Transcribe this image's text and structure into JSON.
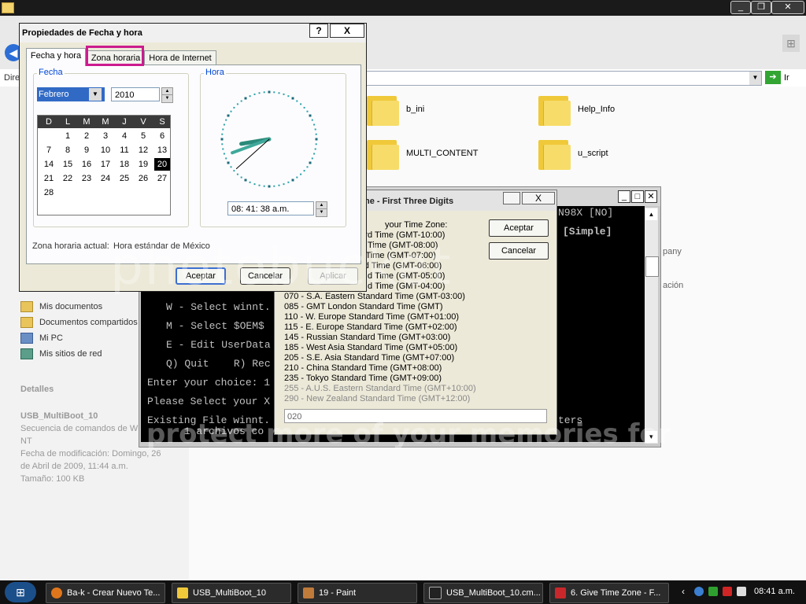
{
  "explorer": {
    "minimize_label": "_",
    "restore_label": "❐",
    "close_label": "✕",
    "address_label": "Direcciones",
    "go_label": "Ir",
    "folders": [
      "b_ini",
      "Help_Info",
      "MULTI_CONTENT",
      "u_script"
    ],
    "right_fragments": [
      "pany",
      "ación"
    ],
    "side_items": [
      "Mis documentos",
      "Documentos compartidos",
      "Mi PC",
      "Mis sitios de red"
    ],
    "details": {
      "title": "Detalles",
      "name": "USB_MultiBoot_10",
      "desc": "Secuencia de comandos de W NT",
      "modified": "Fecha de modificación: Domingo, 26 de Abril de 2009, 11:44 a.m.",
      "size": "Tamaño: 100 KB"
    }
  },
  "cmd": {
    "lines": [
      "N98X [NO]",
      "[Simple]",
      "W - Select winnt.",
      "M - Select $OEM$",
      "E - Edit UserData",
      "Q) Quit    R) Rec",
      "Enter your choice: 1",
      "Please Select your X",
      "Existing File winnt.",
      "      1 archivos co",
      "ters"
    ]
  },
  "tz_dialog": {
    "title": "ne - First Three Digits",
    "prompt": "your Time Zone:",
    "rows": [
      "ndard Time (GMT-10:00)",
      "Time (GMT-08:00)",
      "Standard Time (GMT-07:00)",
      "ard Time (GMT-06:00)",
      "d Time (GMT-05:00)",
      "d Time (GMT-04:00)",
      "070 - S.A. Eastern Standard Time (GMT-03:00)",
      "085 - GMT London Standard Time (GMT)",
      "110 - W. Europe Standard Time (GMT+01:00)",
      "115 - E. Europe Standard Time (GMT+02:00)",
      "145 - Russian Standard Time (GMT+03:00)",
      "185 - West Asia Standard Time (GMT+05:00)",
      "205 - S.E. Asia Standard Time (GMT+07:00)",
      "210 - China Standard Time (GMT+08:00)",
      "235 - Tokyo Standard Time (GMT+09:00)",
      "255 - A.U.S. Eastern Standard Time (GMT+10:00)",
      "290 - New Zealand Standard Time (GMT+12:00)"
    ],
    "input_value": "020",
    "ok_label": "Aceptar",
    "cancel_label": "Cancelar",
    "close_label": "X"
  },
  "dt_dialog": {
    "title": "Propiedades de Fecha y hora",
    "help_label": "?",
    "close_label": "X",
    "tabs": [
      "Fecha y hora",
      "Zona horaria",
      "Hora de Internet"
    ],
    "date_group": "Fecha",
    "time_group": "Hora",
    "month": "Febrero",
    "year": "2010",
    "weekdays": [
      "D",
      "L",
      "M",
      "M",
      "J",
      "V",
      "S"
    ],
    "days": [
      "1",
      "2",
      "3",
      "4",
      "5",
      "6",
      "7",
      "8",
      "9",
      "10",
      "11",
      "12",
      "13",
      "14",
      "15",
      "16",
      "17",
      "18",
      "19",
      "20",
      "21",
      "22",
      "23",
      "24",
      "25",
      "26",
      "27",
      "28"
    ],
    "selected_day": "20",
    "time": "08: 41: 38 a.m.",
    "current_tz_label": "Zona horaria actual:",
    "current_tz_value": "Hora estándar de México",
    "ok_label": "Aceptar",
    "cancel_label": "Cancelar",
    "apply_label": "Aplicar"
  },
  "watermark": {
    "main": "photobucket",
    "bottom": "protect more of your memories for"
  },
  "taskbar": {
    "tasks": [
      "Ba-k - Crear Nuevo Te...",
      "USB_MultiBoot_10",
      "19 - Paint",
      "USB_MultiBoot_10.cm...",
      "6. Give Time Zone - F..."
    ],
    "clock": "08:41 a.m."
  }
}
